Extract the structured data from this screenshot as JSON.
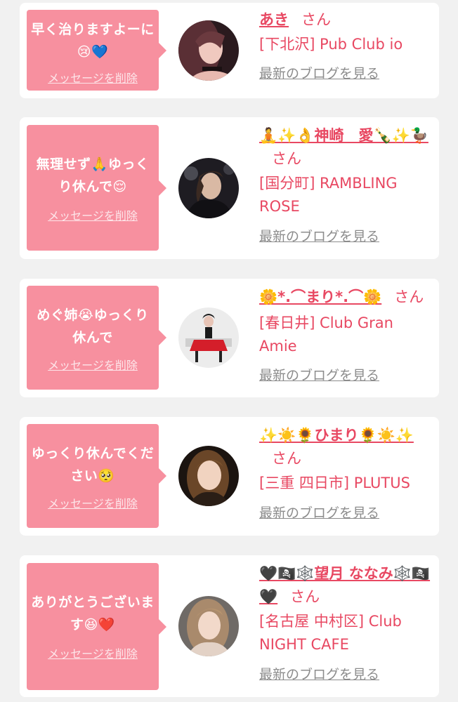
{
  "colors": {
    "page_background": "#f1f1f1",
    "card_background": "#ffffff",
    "bubble_pink": "#f7909f",
    "accent_red": "#e84862",
    "link_gray": "#8c8c8c"
  },
  "common": {
    "delete_label": "メッセージを削除",
    "blog_label": "最新のブログを見る",
    "honorific": "さん"
  },
  "messages": [
    {
      "text": "早く治りますよーに😢💙",
      "name": "あき",
      "shop": "[下北沢] Pub Club io",
      "avatar_icon": "hostess-portrait-dark-hair"
    },
    {
      "text": "無理せず🙏ゆっくり休んで😌",
      "name": "🧘✨👌神崎　愛🍾✨🦆",
      "shop": "[国分町] RAMBLING ROSE",
      "avatar_icon": "hostess-portrait-black-dress"
    },
    {
      "text": "めぐ姉😭ゆっくり休んで",
      "name": "🌼*.⌒まり*.⌒🌼",
      "shop": "[春日井] Club Gran Amie",
      "avatar_icon": "hostess-portrait-red-dress"
    },
    {
      "text": "ゆっくり休んでください🥺",
      "name": "✨☀️🌻ひまり🌻☀️✨",
      "shop": "[三重 四日市] PLUTUS",
      "avatar_icon": "hostess-portrait-brown-hair"
    },
    {
      "text": "ありがとうございます😆❤️",
      "name": "🖤🏴‍☠️🕸️望月 ななみ🕸️🏴‍☠️🖤",
      "shop": "[名古屋 中村区] Club NIGHT CAFE",
      "avatar_icon": "hostess-portrait-light-hair"
    }
  ]
}
